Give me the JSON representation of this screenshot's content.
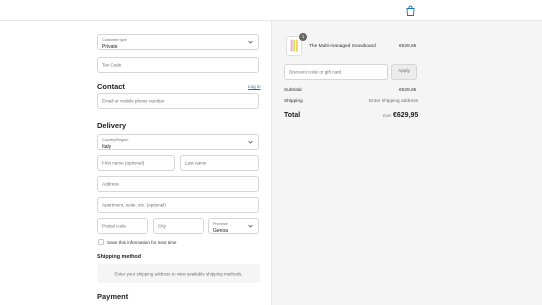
{
  "left": {
    "customer_type": {
      "label": "Customer type",
      "value": "Private"
    },
    "tax_code": {
      "placeholder": "Tax Code"
    },
    "contact": {
      "heading": "Contact",
      "login_link": "Log in",
      "email_placeholder": "Email or mobile phone number"
    },
    "delivery": {
      "heading": "Delivery",
      "country": {
        "label": "Country/Region",
        "value": "Italy"
      },
      "first_name_placeholder": "First name (optional)",
      "last_name_placeholder": "Last name",
      "address_placeholder": "Address",
      "apartment_placeholder": "Apartment, suite, etc. (optional)",
      "postal_code_placeholder": "Postal code",
      "city_placeholder": "City",
      "province": {
        "label": "Province",
        "value": "Genoa"
      },
      "save_info_label": "Save this information for next time"
    },
    "shipping_method": {
      "heading": "Shipping method",
      "message": "Enter your shipping address to view available shipping methods."
    },
    "payment": {
      "heading": "Payment"
    }
  },
  "summary": {
    "product": {
      "name": "The Multi-managed Snowboard",
      "quantity": "1",
      "price": "€629,95"
    },
    "discount_placeholder": "Discount code or gift card",
    "apply_label": "Apply",
    "subtotal_label": "Subtotal",
    "subtotal_value": "€629,95",
    "shipping_label": "Shipping",
    "shipping_value": "Enter shipping address",
    "total_label": "Total",
    "total_currency": "EUR",
    "total_value": "€629,95"
  },
  "colors": {
    "accent": "#1773b0",
    "summary_bg": "#f5f5f5"
  },
  "icons": {
    "cart": "shopping-bag-icon",
    "select": "chevron-down-icon"
  }
}
